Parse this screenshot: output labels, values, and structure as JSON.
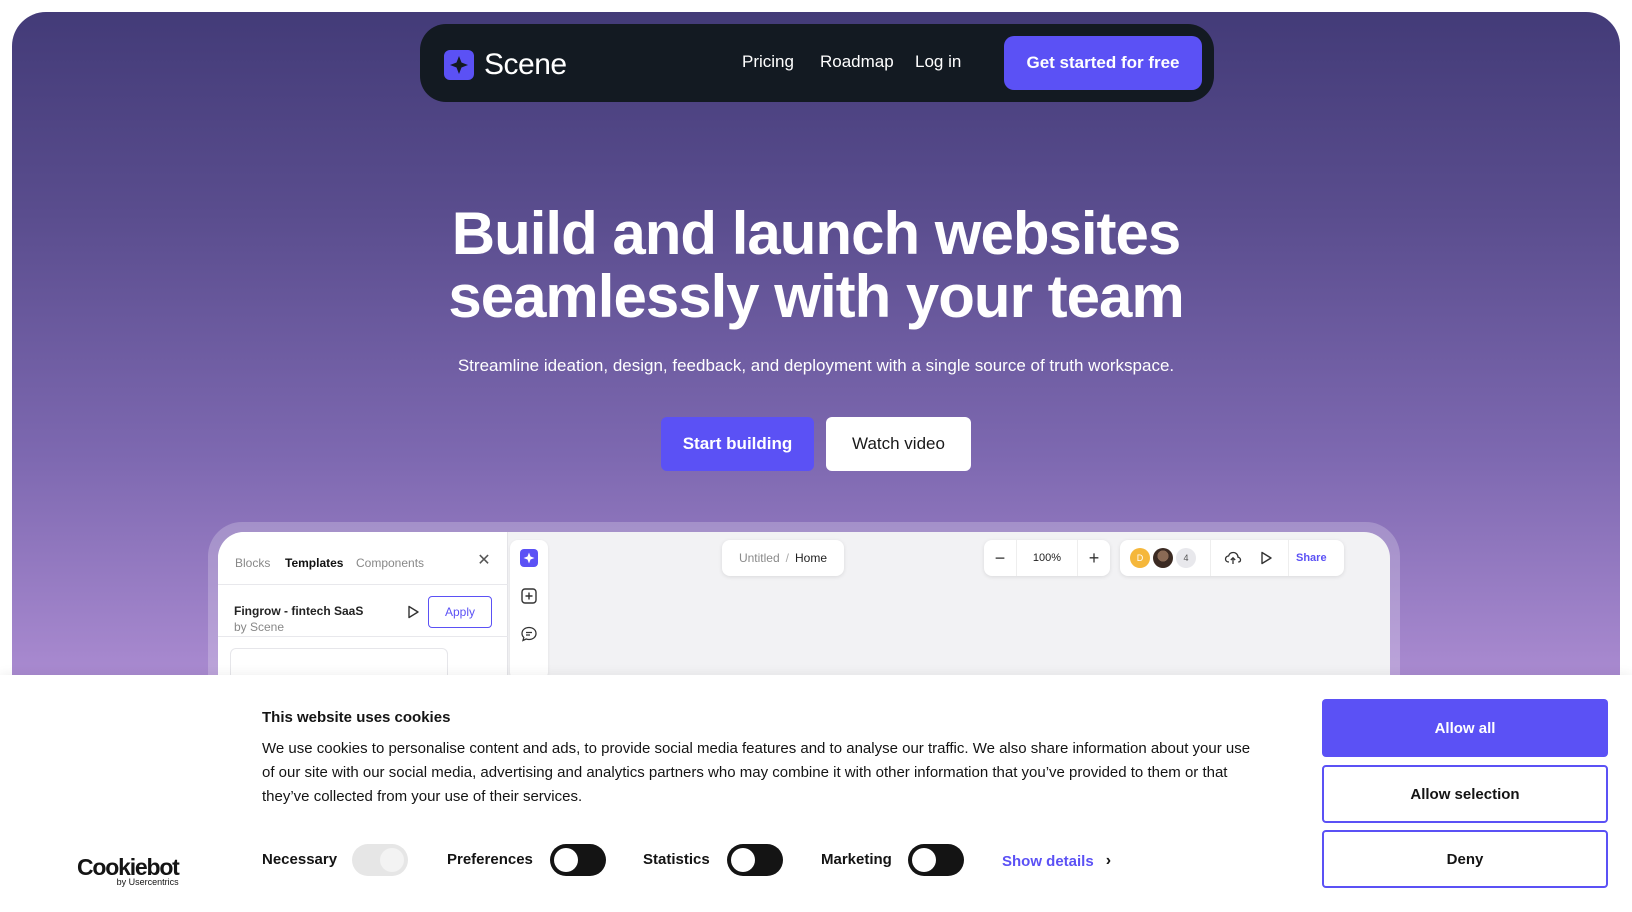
{
  "brand": {
    "name": "Scene",
    "accent": "#5b51f5"
  },
  "nav": {
    "links": [
      "Pricing",
      "Roadmap",
      "Log in"
    ],
    "cta": "Get started for free"
  },
  "hero": {
    "title_line1": "Build and launch websites",
    "title_line2": "seamlessly with your team",
    "subtitle": "Streamline ideation, design, feedback, and deployment with a single source of truth workspace.",
    "primary_button": "Start building",
    "secondary_button": "Watch video"
  },
  "app_preview": {
    "tabs": [
      "Blocks",
      "Templates",
      "Components"
    ],
    "active_tab": "Templates",
    "template_name": "Fingrow - fintech SaaS",
    "template_author": "by Scene",
    "apply_label": "Apply",
    "breadcrumb": {
      "file": "Untitled",
      "separator": "/",
      "page": "Home"
    },
    "zoom_level": "100%",
    "avatar_initial": "D",
    "collaborator_count": "4",
    "share_label": "Share",
    "icons": [
      "close-icon",
      "play-icon",
      "scene-logo-icon",
      "add-block-icon",
      "comment-icon",
      "minus-icon",
      "plus-icon",
      "cloud-sync-icon"
    ]
  },
  "cookie_banner": {
    "logo_main": "Cookiebot",
    "logo_sub": "by Usercentrics",
    "title": "This website uses cookies",
    "body": "We use cookies to personalise content and ads, to provide social media features and to analyse our traffic. We also share information about your use of our site with our social media, advertising and analytics partners who may combine it with other information that you’ve provided to them or that they’ve collected from your use of their services.",
    "consents": [
      {
        "label": "Necessary",
        "checked": true,
        "disabled": true
      },
      {
        "label": "Preferences",
        "checked": false
      },
      {
        "label": "Statistics",
        "checked": false
      },
      {
        "label": "Marketing",
        "checked": false
      }
    ],
    "show_details": "Show details",
    "buttons": {
      "allow_all": "Allow all",
      "allow_selection": "Allow selection",
      "deny": "Deny"
    }
  }
}
